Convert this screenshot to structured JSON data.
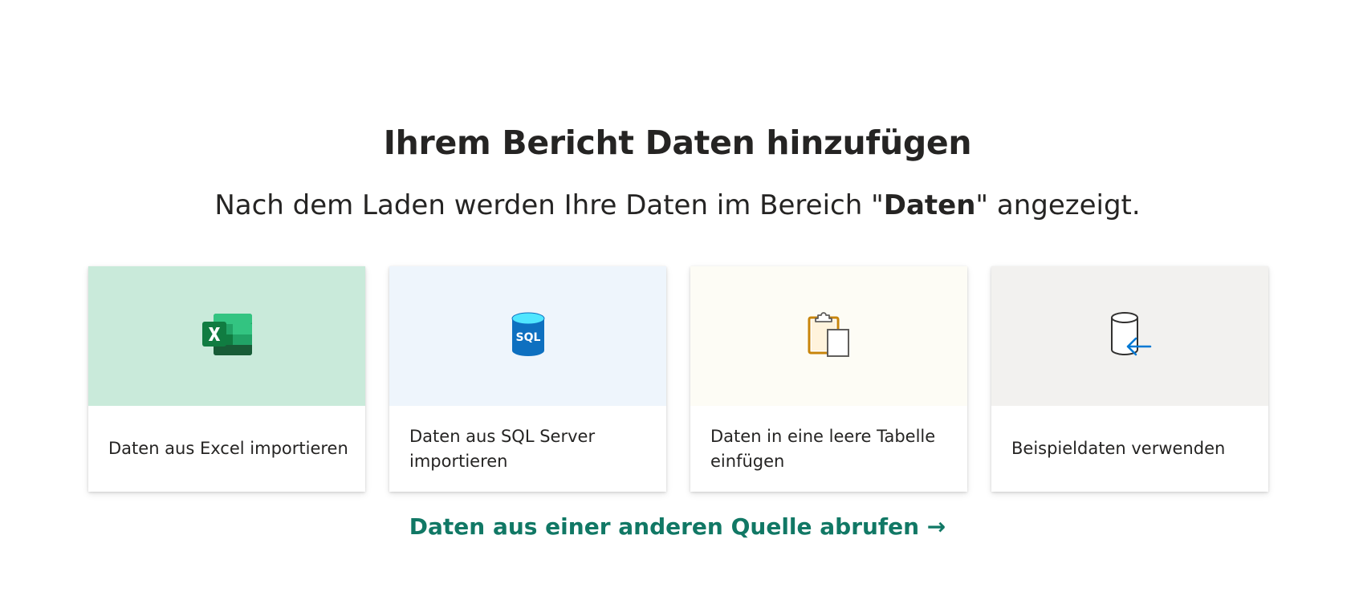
{
  "title": "Ihrem Bericht Daten hinzufügen",
  "subtitle": {
    "before": "Nach dem Laden werden Ihre Daten im Bereich \"",
    "bold": "Daten",
    "after": "\" angezeigt."
  },
  "cards": [
    {
      "label": "Daten aus Excel importieren",
      "icon": "excel-icon",
      "bg_color": "#c9eada"
    },
    {
      "label": "Daten aus SQL Server importieren",
      "icon": "sql-server-icon",
      "icon_text": "SQL",
      "bg_color": "#eef5fc"
    },
    {
      "label": "Daten in eine leere Tabelle einfügen",
      "icon": "paste-clipboard-icon",
      "bg_color": "#fdfcf5"
    },
    {
      "label": "Beispieldaten verwenden",
      "icon": "sample-data-icon",
      "bg_color": "#f2f1ef"
    }
  ],
  "link": {
    "label": "Daten aus einer anderen Quelle abrufen →",
    "color": "#117865"
  }
}
